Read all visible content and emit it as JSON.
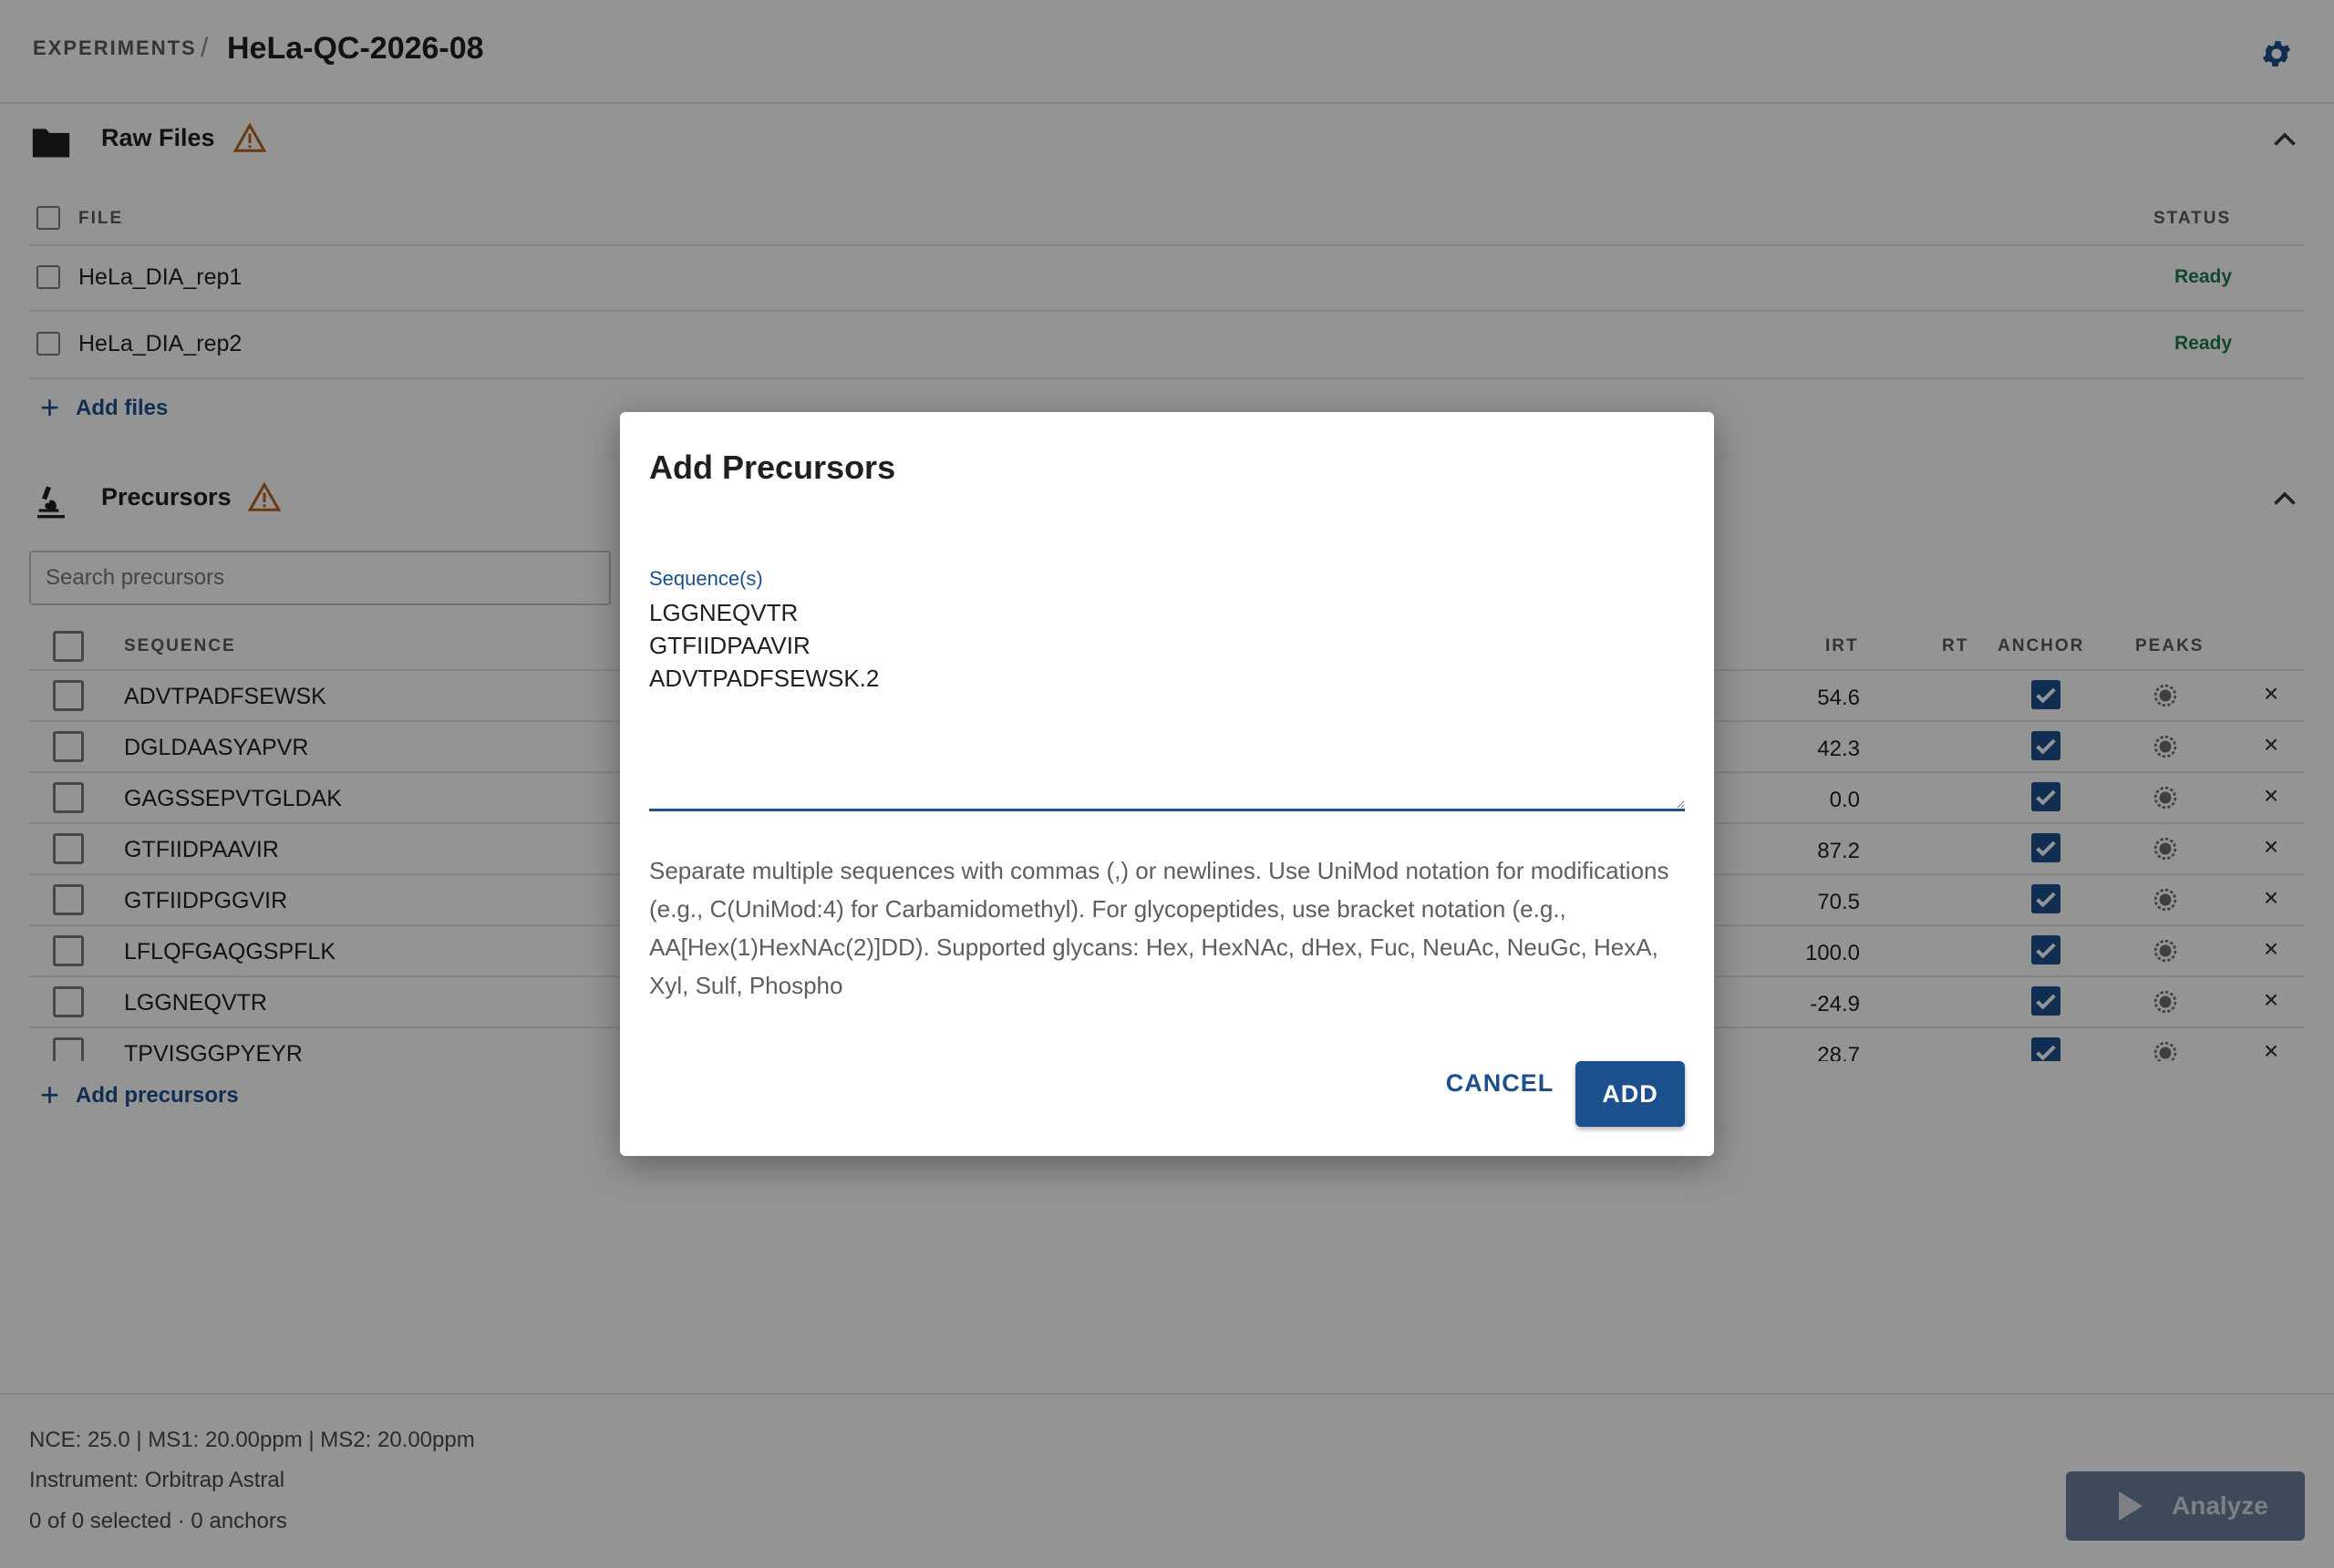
{
  "header": {
    "breadcrumb_root": "EXPERIMENTS",
    "separator": "/",
    "title": "HeLa-QC-2026-08",
    "settings_icon": "gear-icon"
  },
  "raw_files": {
    "title": "Raw Files",
    "columns": {
      "file": "FILE",
      "status": "STATUS"
    },
    "rows": [
      {
        "name": "HeLa_DIA_rep1",
        "status": "Ready"
      },
      {
        "name": "HeLa_DIA_rep2",
        "status": "Ready"
      }
    ],
    "add_label": "Add files"
  },
  "precursors": {
    "title": "Precursors",
    "search_placeholder": "Search precursors",
    "columns": {
      "sequence": "SEQUENCE",
      "irt": "IRT",
      "rt": "RT",
      "anchor": "ANCHOR",
      "peaks": "PEAKS"
    },
    "rows": [
      {
        "sequence": "ADVTPADFSEWSK",
        "irt": "54.6",
        "anchor": true
      },
      {
        "sequence": "DGLDAASYAPVR",
        "irt": "42.3",
        "anchor": true
      },
      {
        "sequence": "GAGSSEPVTGLDAK",
        "irt": "0.0",
        "anchor": true
      },
      {
        "sequence": "GTFIIDPAAVIR",
        "irt": "87.2",
        "anchor": true
      },
      {
        "sequence": "GTFIIDPGGVIR",
        "irt": "70.5",
        "anchor": true
      },
      {
        "sequence": "LFLQFGAQGSPFLK",
        "irt": "100.0",
        "anchor": true
      },
      {
        "sequence": "LGGNEQVTR",
        "irt": "-24.9",
        "anchor": true
      },
      {
        "sequence": "TPVISGGPYEYR",
        "irt": "28.7",
        "anchor": true
      }
    ],
    "delete_glyph": "×",
    "add_label": "Add precursors"
  },
  "footer": {
    "params": "NCE: 25.0 | MS1: 20.00ppm | MS2: 20.00ppm",
    "instrument": "Instrument: Orbitrap Astral",
    "selection": "0 of 0 selected · 0 anchors",
    "analyze_label": "Analyze"
  },
  "dialog": {
    "title": "Add Precursors",
    "field_label": "Sequence(s)",
    "field_value": "LGGNEQVTR\nGTFIIDPAAVIR\nADVTPADFSEWSK.2",
    "helper": "Separate multiple sequences with commas (,) or newlines. Use UniMod notation for modifications (e.g., C(UniMod:4) for Carbamidomethyl). For glycopeptides, use bracket notation (e.g., AA[Hex(1)HexNAc(2)]DD). Supported glycans: Hex, HexNAc, dHex, Fuc, NeuAc, NeuGc, HexA, Xyl, Sulf, Phospho",
    "cancel_label": "CANCEL",
    "add_label": "ADD"
  },
  "colors": {
    "primary": "#1c4f8d",
    "ready": "#1e7a4a",
    "warning": "#b5651d",
    "scrim": "rgba(0,0,0,0.42)"
  }
}
